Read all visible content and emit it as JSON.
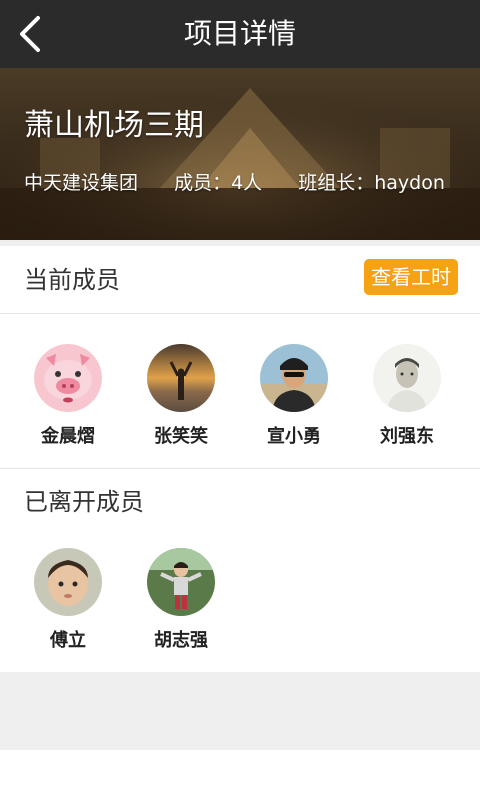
{
  "header": {
    "title": "项目详情",
    "back_icon": "chevron-left-icon"
  },
  "project": {
    "name": "萧山机场三期",
    "company": "中天建设集团",
    "members_text": "成员：4人",
    "leader_text": "班组长：haydon"
  },
  "current_section": {
    "title": "当前成员",
    "hours_button_label": "查看工时",
    "button_color": "#f5a214",
    "members": [
      {
        "name": "金晨熠",
        "avatar": "pig-avatar"
      },
      {
        "name": "张笑笑",
        "avatar": "sunset-avatar"
      },
      {
        "name": "宣小勇",
        "avatar": "person-avatar"
      },
      {
        "name": "刘强东",
        "avatar": "photo-avatar"
      }
    ]
  },
  "left_section": {
    "title": "已离开成员",
    "members": [
      {
        "name": "傅立",
        "avatar": "child-avatar"
      },
      {
        "name": "胡志强",
        "avatar": "girl-avatar"
      }
    ]
  }
}
